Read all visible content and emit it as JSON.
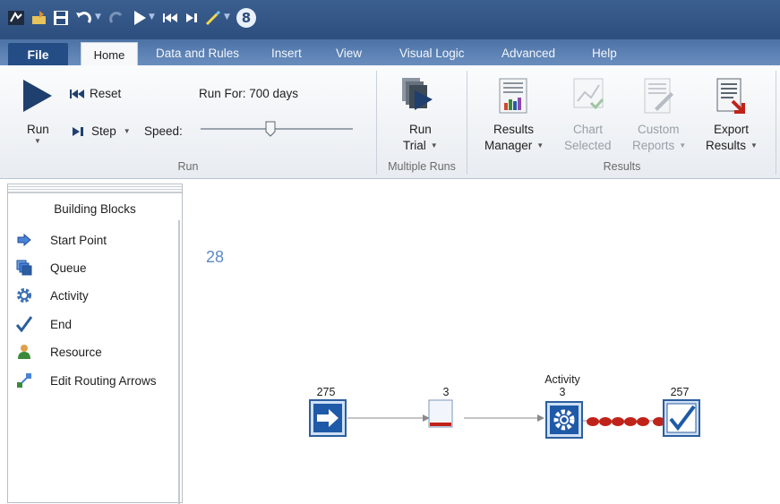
{
  "quick_access": {
    "icons": [
      "app-icon",
      "open-icon",
      "save-icon",
      "undo-icon",
      "redo-icon",
      "run-icon",
      "reset-icon",
      "step-icon",
      "paint-icon"
    ],
    "badge": "8"
  },
  "tabs": {
    "file": "File",
    "home": "Home",
    "data_and_rules": "Data and Rules",
    "insert": "Insert",
    "view": "View",
    "visual_logic": "Visual Logic",
    "advanced": "Advanced",
    "help": "Help"
  },
  "ribbon": {
    "run": {
      "run_label": "Run",
      "reset_label": "Reset",
      "step_label": "Step",
      "speed_label": "Speed:",
      "run_for_label": "Run For: 700 days",
      "group_label": "Run"
    },
    "multiple_runs": {
      "run_trial_line1": "Run",
      "run_trial_line2": "Trial",
      "group_label": "Multiple Runs"
    },
    "results": {
      "results_manager_line1": "Results",
      "results_manager_line2": "Manager",
      "chart_selected_line1": "Chart",
      "chart_selected_line2": "Selected",
      "custom_reports_line1": "Custom",
      "custom_reports_line2": "Reports",
      "export_results_line1": "Export",
      "export_results_line2": "Results",
      "group_label": "Results"
    }
  },
  "sidebar": {
    "title": "Building Blocks",
    "items": [
      {
        "label": "Start Point",
        "icon": "arrow-right-icon"
      },
      {
        "label": "Queue",
        "icon": "queue-icon"
      },
      {
        "label": "Activity",
        "icon": "gear-icon"
      },
      {
        "label": "End",
        "icon": "checkmark-icon"
      },
      {
        "label": "Resource",
        "icon": "person-icon"
      },
      {
        "label": "Edit Routing Arrows",
        "icon": "routing-arrow-icon"
      }
    ]
  },
  "canvas": {
    "clock": "28",
    "start_count": "275",
    "queue_count": "3",
    "activity_name": "Activity",
    "activity_count": "3",
    "end_count": "257"
  },
  "colors": {
    "accent": "#2c5e9e",
    "titlebar": "#2c4e7e",
    "clock": "#5b8ac7",
    "entity": "#c0231a"
  }
}
